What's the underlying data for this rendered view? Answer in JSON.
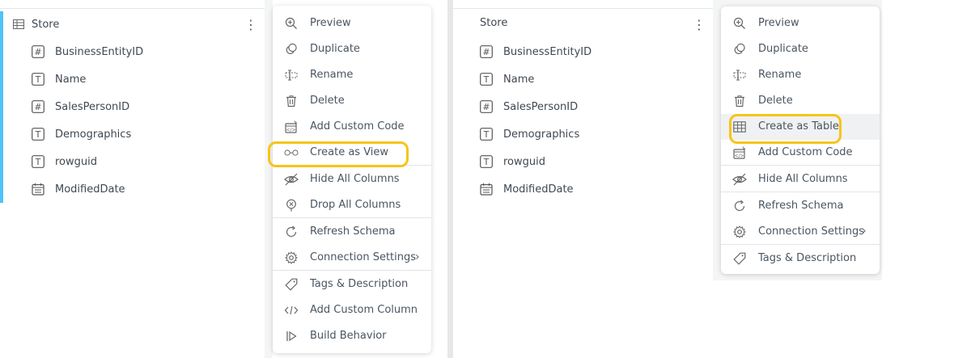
{
  "left": {
    "header": "Store",
    "columns": [
      {
        "label": "BusinessEntityID",
        "type": "number"
      },
      {
        "label": "Name",
        "type": "text"
      },
      {
        "label": "SalesPersonID",
        "type": "number"
      },
      {
        "label": "Demographics",
        "type": "text"
      },
      {
        "label": "rowguid",
        "type": "text"
      },
      {
        "label": "ModifiedDate",
        "type": "date"
      }
    ],
    "menu": [
      {
        "label": "Preview",
        "icon": "zoom-in-icon"
      },
      {
        "label": "Duplicate",
        "icon": "duplicate-icon"
      },
      {
        "label": "Rename",
        "icon": "rename-icon"
      },
      {
        "label": "Delete",
        "icon": "trash-icon"
      },
      {
        "label": "Add Custom Code",
        "icon": "custom-code-icon"
      },
      {
        "label": "Create as View",
        "icon": "glasses-icon"
      },
      {
        "label": "Hide All Columns",
        "icon": "eye-off-icon"
      },
      {
        "label": "Drop All Columns",
        "icon": "drop-icon"
      },
      {
        "label": "Refresh Schema",
        "icon": "refresh-icon"
      },
      {
        "label": "Connection Settings",
        "icon": "gear-icon"
      },
      {
        "label": "Tags & Description",
        "icon": "tag-icon"
      },
      {
        "label": "Add Custom Column",
        "icon": "code-icon"
      },
      {
        "label": "Build Behavior",
        "icon": "build-icon"
      }
    ]
  },
  "right": {
    "header": "Store",
    "columns": [
      {
        "label": "BusinessEntityID",
        "type": "number"
      },
      {
        "label": "Name",
        "type": "text"
      },
      {
        "label": "SalesPersonID",
        "type": "number"
      },
      {
        "label": "Demographics",
        "type": "text"
      },
      {
        "label": "rowguid",
        "type": "text"
      },
      {
        "label": "ModifiedDate",
        "type": "date"
      }
    ],
    "menu": [
      {
        "label": "Preview",
        "icon": "zoom-in-icon"
      },
      {
        "label": "Duplicate",
        "icon": "duplicate-icon"
      },
      {
        "label": "Rename",
        "icon": "rename-icon"
      },
      {
        "label": "Delete",
        "icon": "trash-icon"
      },
      {
        "label": "Create as Table",
        "icon": "table-icon"
      },
      {
        "label": "Add Custom Code",
        "icon": "custom-code-icon"
      },
      {
        "label": "Hide All Columns",
        "icon": "eye-off-icon"
      },
      {
        "label": "Refresh Schema",
        "icon": "refresh-icon"
      },
      {
        "label": "Connection Settings",
        "icon": "gear-icon"
      },
      {
        "label": "Tags & Description",
        "icon": "tag-icon"
      }
    ]
  },
  "colors": {
    "highlight_ring": "#f5c518",
    "accent_bar": "#4fc3f7"
  }
}
